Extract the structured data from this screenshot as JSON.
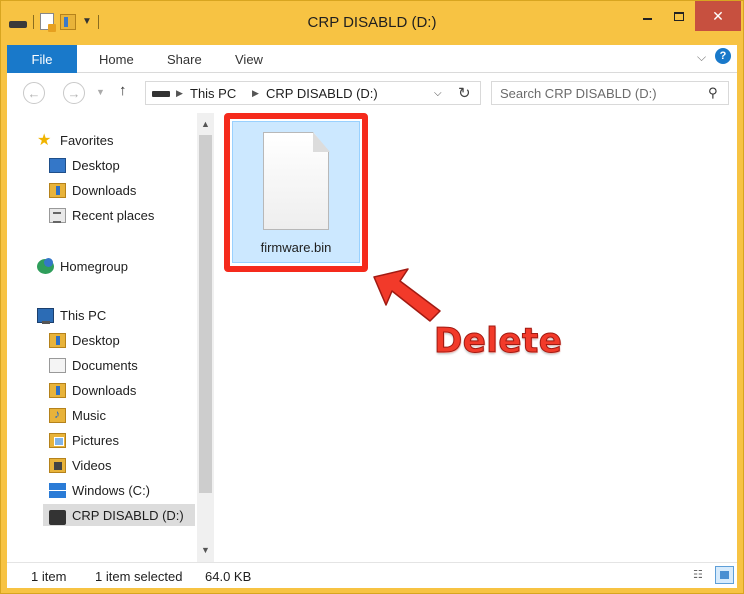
{
  "window": {
    "title": "CRP DISABLD (D:)",
    "controls": {
      "minimize": "",
      "maximize": "",
      "close": "✕"
    },
    "colors": {
      "frame": "#f7c343",
      "close": "#c7503f",
      "accent": "#1979ca"
    }
  },
  "ribbon": {
    "tabs": [
      {
        "label": "File"
      },
      {
        "label": "Home"
      },
      {
        "label": "Share"
      },
      {
        "label": "View"
      }
    ],
    "expand_icon": "chevron-down-icon",
    "help_label": "?"
  },
  "address": {
    "crumbs": [
      "This PC",
      "CRP DISABLD (D:)"
    ],
    "search_placeholder": "Search CRP DISABLD (D:)"
  },
  "nav": {
    "favorites": {
      "label": "Favorites",
      "items": [
        "Desktop",
        "Downloads",
        "Recent places"
      ]
    },
    "homegroup": {
      "label": "Homegroup"
    },
    "this_pc": {
      "label": "This PC",
      "items": [
        "Desktop",
        "Documents",
        "Downloads",
        "Music",
        "Pictures",
        "Videos",
        "Windows (C:)",
        "CRP DISABLD (D:)"
      ]
    },
    "selected": "CRP DISABLD (D:)"
  },
  "content": {
    "files": [
      {
        "name": "firmware.bin",
        "icon": "file-icon",
        "selected": true
      }
    ]
  },
  "annotation": {
    "text": "Delete",
    "color": "#f23a2a"
  },
  "status": {
    "count": "1 item",
    "selected": "1 item selected",
    "size": "64.0 KB"
  }
}
